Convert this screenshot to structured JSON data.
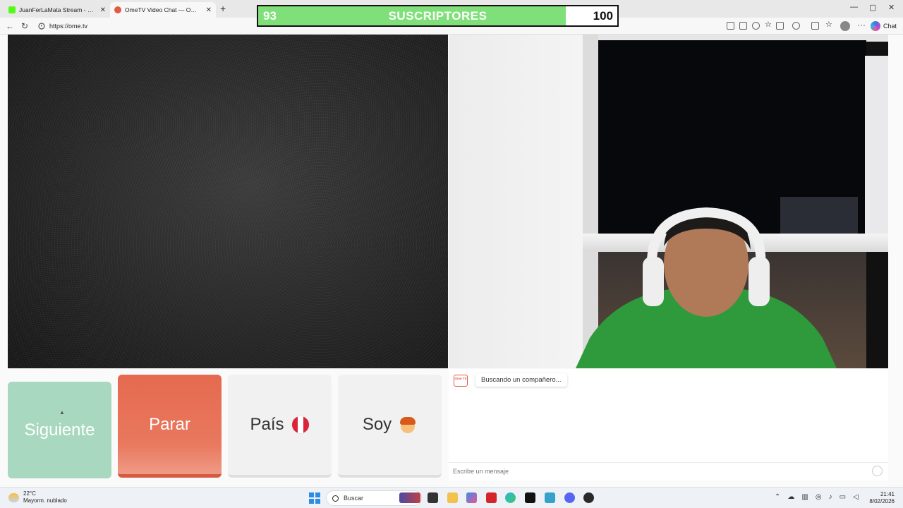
{
  "browser": {
    "tabs": [
      {
        "title": "JuanFerLaMata Stream - Watch Li",
        "active": false,
        "favicon_color": "#53fc18"
      },
      {
        "title": "OmeTV Video Chat — Omegle",
        "active": true,
        "favicon_color": "#e05a45"
      }
    ],
    "url": "https://ome.tv",
    "chat_button_label": "Chat"
  },
  "overlay": {
    "current": "93",
    "label": "SUSCRIPTORES",
    "goal": "100",
    "progress": 0.93
  },
  "controls": {
    "next_label": "Siguiente",
    "stop_label": "Parar",
    "country_label": "País",
    "country_flag": "peru-flag-icon",
    "gender_label": "Soy",
    "gender_icon": "boy-emoji-icon"
  },
  "chat": {
    "status_message": "Buscando un compañero...",
    "logo_text": "Ome TV",
    "input_placeholder": "Escribe un mensaje"
  },
  "taskbar": {
    "weather_temp": "22°C",
    "weather_desc": "Mayorm. nublado",
    "search_label": "Buscar",
    "time": "21:41",
    "date": "8/02/2026"
  },
  "colors": {
    "next_button": "#a8d8bf",
    "stop_button": "#e56a4f",
    "overlay_fill": "#7fe07a"
  }
}
